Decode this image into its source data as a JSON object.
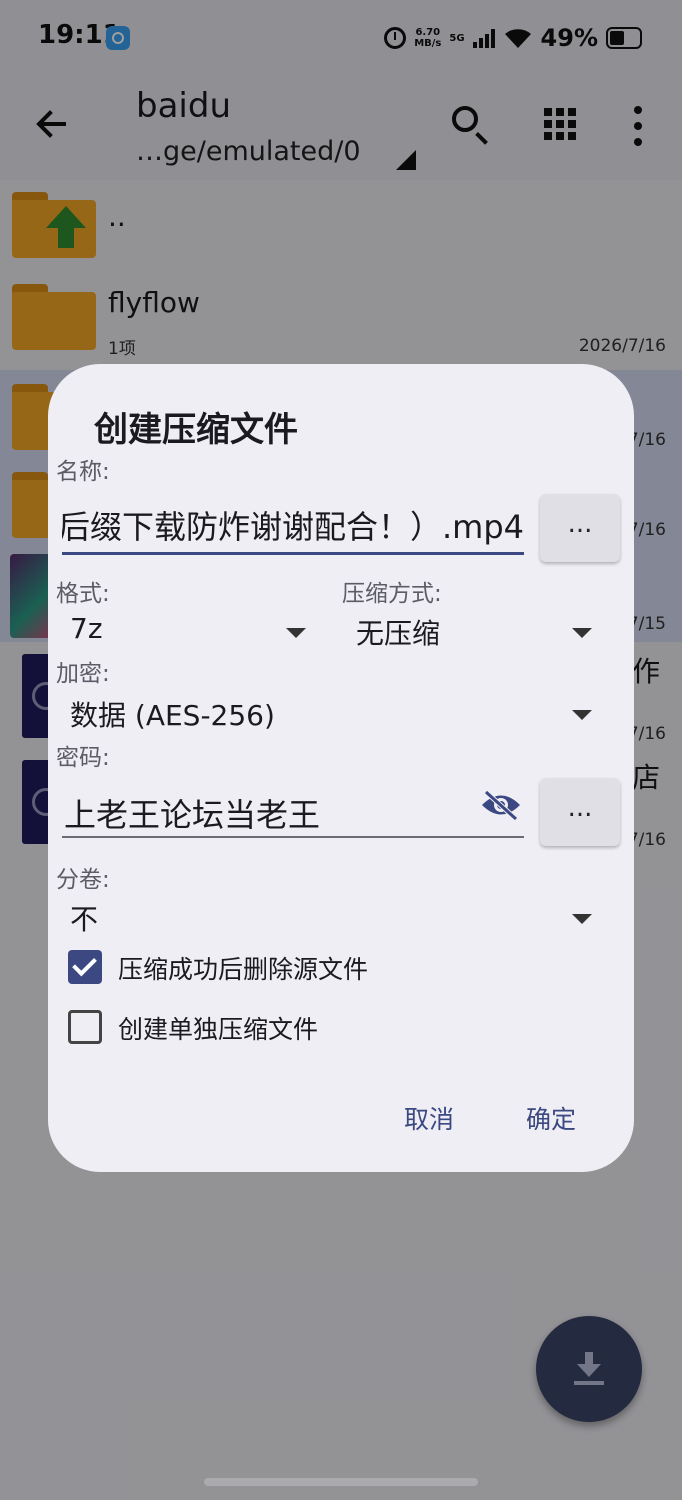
{
  "status_bar": {
    "time": "19:11",
    "speed_value": "6.70",
    "speed_unit": "MB/s",
    "network": "5G",
    "battery": "49%"
  },
  "toolbar": {
    "title": "baidu",
    "path": "…ge/emulated/0"
  },
  "files": [
    {
      "name": "..",
      "sub": "",
      "date": ""
    },
    {
      "name": "flyflow",
      "sub": "1项",
      "date": "2026/7/16"
    },
    {
      "name": "",
      "sub": "",
      "date": "7/16"
    },
    {
      "name": "",
      "sub": "",
      "date": "7/16"
    },
    {
      "name": "",
      "sub": "",
      "date": "7/15"
    },
    {
      "name": "作",
      "sub": "",
      "date": "7/16"
    },
    {
      "name": "店",
      "sub": "",
      "date": "7/16"
    }
  ],
  "dialog": {
    "title": "创建压缩文件",
    "name_label": "名称:",
    "name_value": "后缀下载防炸谢谢配合！）.mp4",
    "browse_label": "...",
    "format_label": "格式:",
    "format_value": "7z",
    "method_label": "压缩方式:",
    "method_value": "无压缩",
    "encrypt_label": "加密:",
    "encrypt_value": "数据 (AES-256)",
    "password_label": "密码:",
    "password_value": "上老王论坛当老王",
    "password_more": "...",
    "split_label": "分卷:",
    "split_value": "不",
    "delete_source_label": "压缩成功后删除源文件",
    "delete_source_checked": true,
    "separate_label": "创建单独压缩文件",
    "separate_checked": false,
    "cancel": "取消",
    "confirm": "确定"
  },
  "colors": {
    "accent": "#3b4882",
    "fab": "#3a4468",
    "folder": "#f3a626"
  },
  "icons": {
    "back": "arrow-left-icon",
    "search": "search-icon",
    "grid": "grid-view-icon",
    "more": "more-vert-icon",
    "eye": "eye-off-icon",
    "fab": "download-icon"
  }
}
